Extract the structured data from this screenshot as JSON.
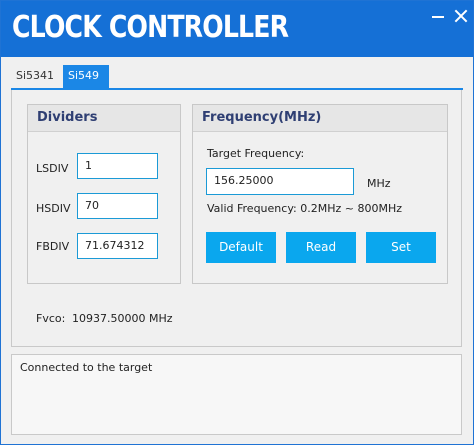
{
  "app": {
    "title": "CLOCK CONTROLLER"
  },
  "window_controls": {
    "minimize_icon": "minimize-icon",
    "close_icon": "close-icon"
  },
  "tabs": [
    {
      "label": "Si5341",
      "active": false
    },
    {
      "label": "Si549",
      "active": true
    }
  ],
  "dividers": {
    "title": "Dividers",
    "lsdiv": {
      "label": "LSDIV",
      "value": "1"
    },
    "hsdiv": {
      "label": "HSDIV",
      "value": "70"
    },
    "fbdiv": {
      "label": "FBDIV",
      "value": "71.674312"
    }
  },
  "frequency": {
    "title": "Frequency(MHz)",
    "target_label": "Target Frequency:",
    "target_value": "156.25000",
    "unit": "MHz",
    "valid_range": "Valid Frequency: 0.2MHz ~ 800MHz",
    "buttons": {
      "default": "Default",
      "read": "Read",
      "set": "Set"
    }
  },
  "fvco": {
    "label": "Fvco:",
    "value": "10937.50000 MHz"
  },
  "status": {
    "text": "Connected to the target"
  },
  "colors": {
    "titlebar": "#1570d6",
    "accent": "#1b87e6",
    "button": "#0aa7ee",
    "group_title": "#2f3f73"
  }
}
